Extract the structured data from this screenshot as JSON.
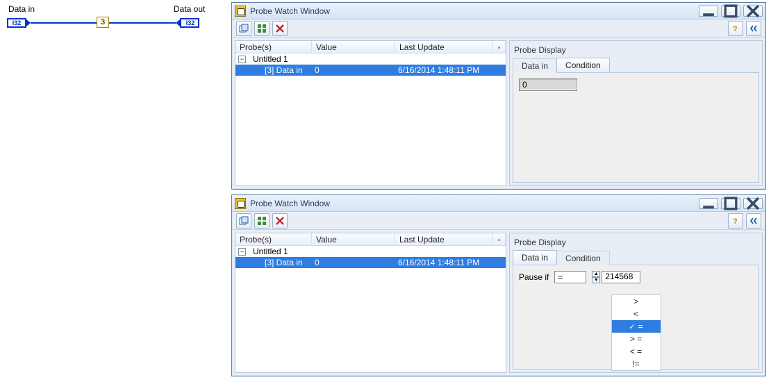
{
  "diagram": {
    "data_in_label": "Data in",
    "data_out_label": "Data out",
    "probe_number": "3",
    "i32_text": "I32"
  },
  "win1": {
    "title": "Probe Watch Window",
    "columns": {
      "c1": "Probe(s)",
      "c2": "Value",
      "c3": "Last Update"
    },
    "root": "Untitled 1",
    "row": {
      "name": "[3] Data in",
      "value": "0",
      "ts": "6/16/2014 1:48:11 PM"
    },
    "probe_display_title": "Probe Display",
    "tab_data": "Data in",
    "tab_cond": "Condition",
    "probe_value": "0"
  },
  "win2": {
    "title": "Probe Watch Window",
    "columns": {
      "c1": "Probe(s)",
      "c2": "Value",
      "c3": "Last Update"
    },
    "root": "Untitled 1",
    "row": {
      "name": "[3] Data in",
      "value": "0",
      "ts": "6/16/2014 1:48:11 PM"
    },
    "probe_display_title": "Probe Display",
    "tab_data": "Data in",
    "tab_cond": "Condition",
    "pause_if_label": "Pause if",
    "op_selected": "=",
    "num_value": "214568",
    "ops": [
      ">",
      "<",
      "=",
      "> =",
      "< =",
      "!="
    ]
  }
}
